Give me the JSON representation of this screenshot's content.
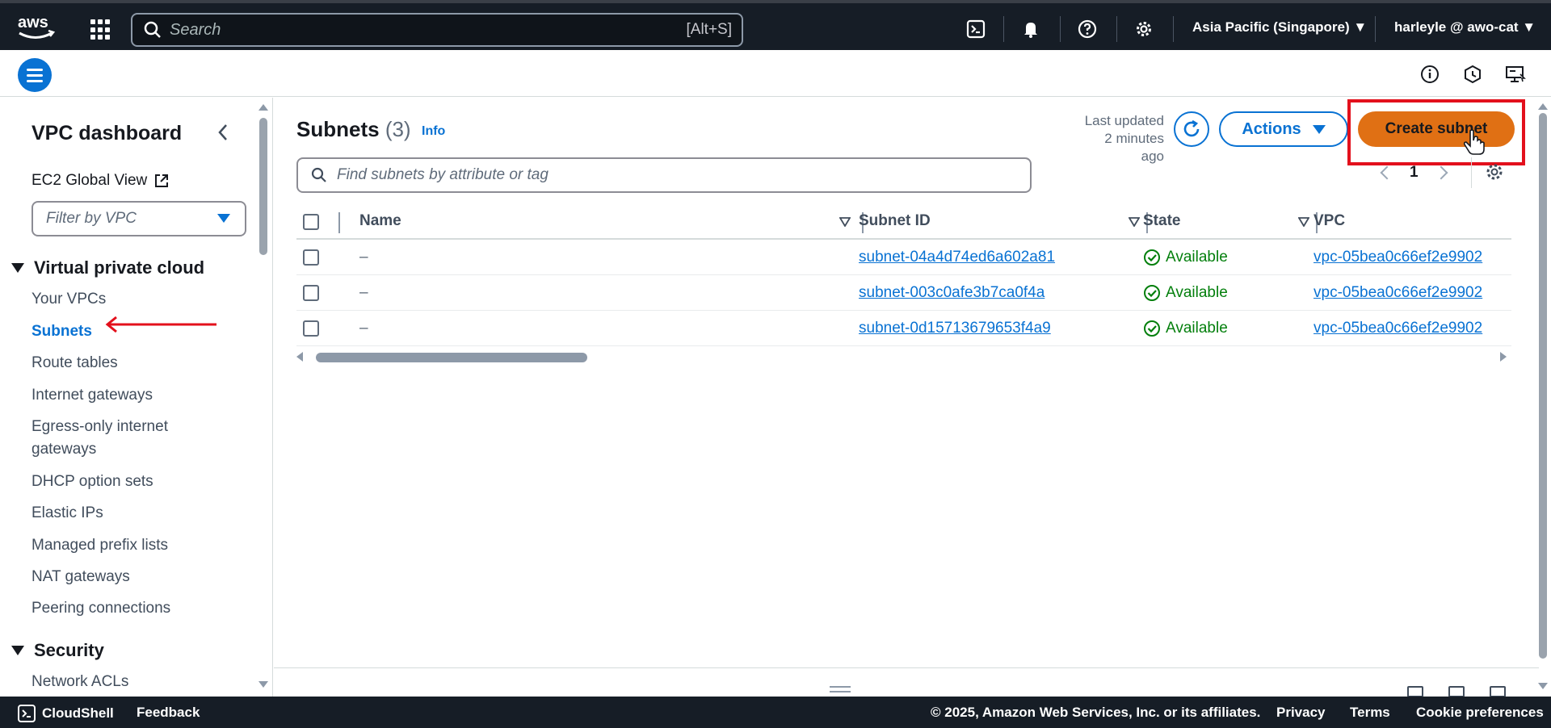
{
  "topbar": {
    "search_placeholder": "Search",
    "search_shortcut": "[Alt+S]",
    "region": "Asia Pacific (Singapore) ▼",
    "user": "harleyle @ awo-cat ▼"
  },
  "sidebar": {
    "title": "VPC dashboard",
    "ec2_global_view": "EC2 Global View",
    "filter_placeholder": "Filter by VPC",
    "section_vpc": "Virtual private cloud",
    "items": [
      {
        "label": "Your VPCs",
        "active": false
      },
      {
        "label": "Subnets",
        "active": true
      },
      {
        "label": "Route tables",
        "active": false
      },
      {
        "label": "Internet gateways",
        "active": false
      },
      {
        "label": "Egress-only internet",
        "active": false
      },
      {
        "label": "gateways",
        "active": false
      },
      {
        "label": "DHCP option sets",
        "active": false
      },
      {
        "label": "Elastic IPs",
        "active": false
      },
      {
        "label": "Managed prefix lists",
        "active": false
      },
      {
        "label": "NAT gateways",
        "active": false
      },
      {
        "label": "Peering connections",
        "active": false
      }
    ],
    "section_security": "Security",
    "security_items": [
      {
        "label": "Network ACLs"
      }
    ]
  },
  "main": {
    "title": "Subnets",
    "count": "(3)",
    "info": "Info",
    "last_updated_line1": "Last updated",
    "last_updated_line2": "2 minutes ago",
    "actions_label": "Actions",
    "create_label": "Create subnet",
    "filter_placeholder": "Find subnets by attribute or tag",
    "page_number": "1",
    "columns": {
      "name": "Name",
      "subnet_id": "Subnet ID",
      "state": "State",
      "vpc": "VPC"
    },
    "rows": [
      {
        "name": "–",
        "subnet_id": "subnet-04a4d74ed6a602a81",
        "state": "Available",
        "vpc": "vpc-05bea0c66ef2e9902"
      },
      {
        "name": "–",
        "subnet_id": "subnet-003c0afe3b7ca0f4a",
        "state": "Available",
        "vpc": "vpc-05bea0c66ef2e9902"
      },
      {
        "name": "–",
        "subnet_id": "subnet-0d15713679653f4a9",
        "state": "Available",
        "vpc": "vpc-05bea0c66ef2e9902"
      }
    ]
  },
  "footer": {
    "cloudshell": "CloudShell",
    "feedback": "Feedback",
    "copyright": "© 2025, Amazon Web Services, Inc. or its affiliates.",
    "privacy": "Privacy",
    "terms": "Terms",
    "cookie": "Cookie preferences"
  },
  "colors": {
    "nav_bg": "#161d26",
    "link_blue": "#0972d3",
    "primary_orange": "#e07014",
    "available_green": "#037f0c",
    "highlight_red": "#e3101c"
  }
}
